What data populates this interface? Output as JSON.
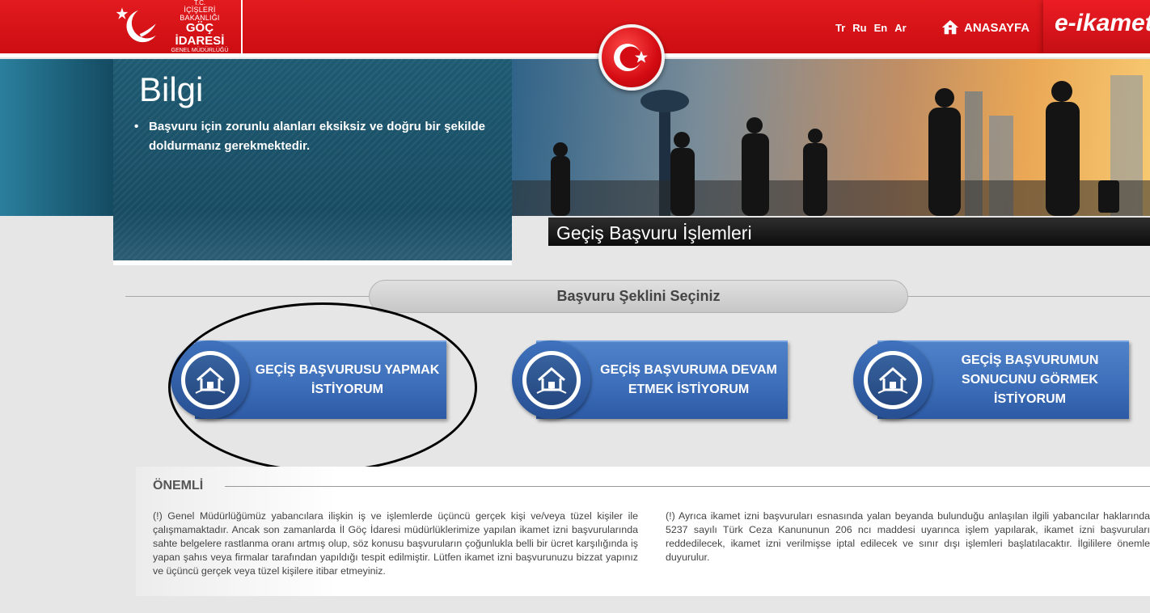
{
  "header": {
    "logo": {
      "line1": "T.C.",
      "line2": "İÇİŞLERİ BAKANLIĞI",
      "line3": "GÖÇ İDARESİ",
      "line4": "GENEL MÜDÜRLÜĞÜ"
    },
    "languages": [
      "Tr",
      "Ru",
      "En",
      "Ar"
    ],
    "home_label": "ANASAYFA",
    "eikamet_label": "e-ikamet"
  },
  "info": {
    "title": "Bilgi",
    "text": "Başvuru için zorunlu alanları eksiksiz ve doğru bir şekilde doldurmanız gerekmektedir."
  },
  "page_heading": "Geçiş Başvuru İşlemleri",
  "selection": {
    "title": "Başvuru Şeklini Seçiniz",
    "options": [
      {
        "label": "GEÇİŞ BAŞVURUSU YAPMAK İSTİYORUM"
      },
      {
        "label": "GEÇİŞ BAŞVURUMA DEVAM ETMEK İSTİYORUM"
      },
      {
        "label": "GEÇİŞ BAŞVURUMUN SONUCUNU GÖRMEK İSTİYORUM"
      }
    ]
  },
  "notice": {
    "title": "ÖNEMLİ",
    "col1": "(!) Genel Müdürlüğümüz yabancılara ilişkin iş ve işlemlerde üçüncü gerçek kişi ve/veya tüzel kişiler ile çalışmamaktadır. Ancak son zamanlarda İl Göç İdaresi müdürlüklerimize yapılan ikamet izni başvurularında sahte belgelere rastlanma oranı artmış olup, söz konusu başvuruların çoğunlukla belli bir ücret karşılığında iş yapan şahıs veya firmalar tarafından yapıldığı tespit edilmiştir. Lütfen ikamet izni başvurunuzu bizzat yapınız ve üçüncü gerçek veya tüzel kişilere itibar etmeyiniz.",
    "col2": "(!) Ayrıca ikamet izni başvuruları esnasında yalan beyanda bulunduğu anlaşılan ilgili yabancılar haklarında 5237 sayılı Türk Ceza Kanununun 206 ncı maddesi uyarınca işlem yapılarak, ikamet izni başvuruları reddedilecek, ikamet izni verilmişse iptal edilecek ve sınır dışı işlemleri başlatılacaktır. İlgililere önemle duyurulur."
  },
  "colors": {
    "header_red": "#e21b1f",
    "panel_blue": "#1e5a72",
    "button_blue": "#3e6fba"
  }
}
